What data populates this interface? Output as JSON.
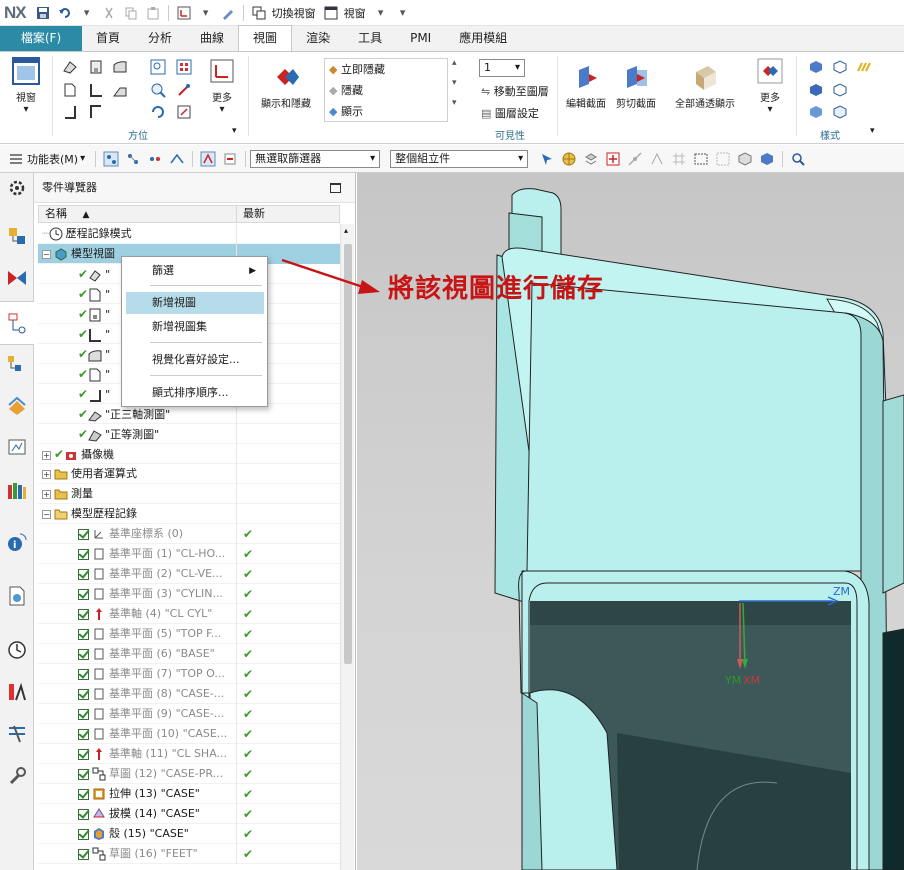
{
  "qat": {
    "logo": "NX",
    "switch_window": "切換視窗",
    "window": "視窗"
  },
  "tabs": [
    "檔案(F)",
    "首頁",
    "分析",
    "曲線",
    "視圖",
    "渲染",
    "工具",
    "PMI",
    "應用模組"
  ],
  "active_tab": "視圖",
  "ribbon": {
    "view_btn": "視窗",
    "orient_group": "方位",
    "more1": "更多",
    "show_hide": "顯示和隱藏",
    "immediate_hide": "立即隱藏",
    "hide": "隱藏",
    "show": "顯示",
    "layer_value": "1",
    "move_to_layer": "移動至圖層",
    "layer_settings": "圖層設定",
    "visibility_group": "可見性",
    "edit_section": "編輯截面",
    "clip_section": "剪切截面",
    "all_see_through": "全部通透顯示",
    "more2": "更多",
    "style_group": "樣式"
  },
  "toolbar2": {
    "menu": "功能表(M)",
    "filter": "無選取篩選器",
    "assembly": "整個組立件"
  },
  "nav": {
    "title": "零件導覽器",
    "col_name": "名稱",
    "col_latest": "最新",
    "rows": [
      {
        "label": "歷程記錄模式"
      },
      {
        "label": "模型視圖"
      },
      {
        "label": "\"正三軸測圖\""
      },
      {
        "label": "\"正等測圖\""
      },
      {
        "label": "攝像機"
      },
      {
        "label": "使用者運算式"
      },
      {
        "label": "測量"
      },
      {
        "label": "模型歷程記錄"
      },
      {
        "label": "基準座標系 (0)"
      },
      {
        "label": "基準平面 (1) \"CL-HO..."
      },
      {
        "label": "基準平面 (2) \"CL-VE..."
      },
      {
        "label": "基準平面 (3) \"CYLIN..."
      },
      {
        "label": "基準軸 (4) \"CL CYL\""
      },
      {
        "label": "基準平面 (5) \"TOP F..."
      },
      {
        "label": "基準平面 (6) \"BASE\""
      },
      {
        "label": "基準平面 (7) \"TOP O..."
      },
      {
        "label": "基準平面 (8) \"CASE-..."
      },
      {
        "label": "基準平面 (9) \"CASE-..."
      },
      {
        "label": "基準平面 (10) \"CASE..."
      },
      {
        "label": "基準軸 (11) \"CL SHA..."
      },
      {
        "label": "草圖 (12) \"CASE-PR..."
      },
      {
        "label": "拉伸 (13) \"CASE\""
      },
      {
        "label": "拔模 (14) \"CASE\""
      },
      {
        "label": "殼 (15) \"CASE\""
      },
      {
        "label": "草圖 (16) \"FEET\""
      }
    ]
  },
  "context_menu": {
    "filter": "篩選",
    "new_view": "新增視圖",
    "new_view_set": "新增視圖集",
    "visual_prefs": "視覺化喜好設定...",
    "display_order": "顯式排序順序..."
  },
  "annotation": "將該視圖進行儲存",
  "axes": {
    "z": "ZM",
    "y": "YM",
    "x": "XM"
  },
  "colors": {
    "file_tab": "#2b8aa6",
    "selection": "#9fd0e2",
    "annotation": "#c81414",
    "model": "#b9f0ee"
  }
}
